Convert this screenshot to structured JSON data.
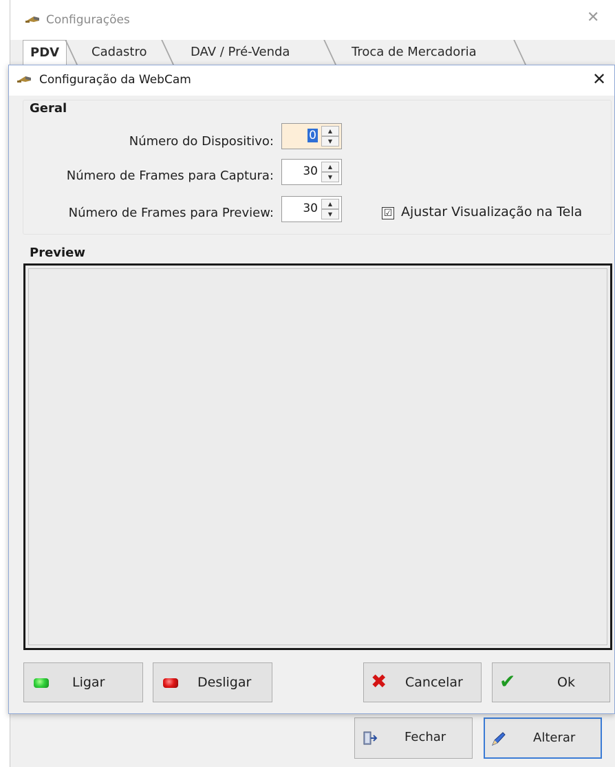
{
  "parent_window": {
    "title": "Configurações",
    "tabs": [
      {
        "label": "PDV"
      },
      {
        "label": "Cadastro"
      },
      {
        "label": "DAV / Pré-Venda"
      },
      {
        "label": "Troca de Mercadoria"
      }
    ],
    "buttons": {
      "close_label": "Fechar",
      "edit_label": "Alterar"
    },
    "icons": {
      "app": "drill-app-icon",
      "close": "close-icon",
      "fechar": "exit-door-icon",
      "alterar": "pencil-edit-icon"
    }
  },
  "dialog": {
    "title": "Configuração da WebCam",
    "geral": {
      "group_label": "Geral",
      "device_number": {
        "label": "Número do Dispositivo:",
        "value": "0"
      },
      "capture_frames": {
        "label": "Número de Frames para Captura:",
        "value": "30"
      },
      "preview_frames": {
        "label": "Número de Frames para Preview:",
        "value": "30"
      },
      "fit_to_screen": {
        "label": "Ajustar Visualização na Tela",
        "checked": true,
        "mark": "☑"
      }
    },
    "preview": {
      "group_label": "Preview"
    },
    "buttons": {
      "ligar": "Ligar",
      "desligar": "Desligar",
      "cancelar": "Cancelar",
      "ok": "Ok"
    },
    "colors": {
      "led_on": "#2fcf3a",
      "led_off": "#e01515",
      "cancel_x": "#d41414",
      "ok_check": "#1f9a22",
      "spin_active_bg": "#fdeed8",
      "selection": "#2f6fd6"
    }
  }
}
